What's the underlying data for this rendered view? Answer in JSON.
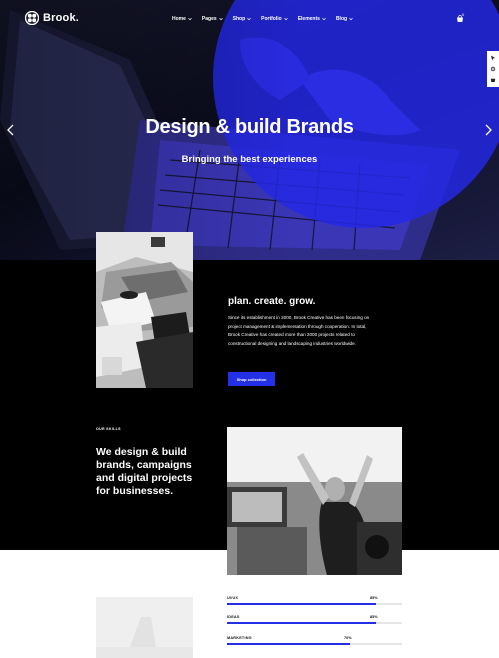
{
  "nav": {
    "logo_text": "Brook.",
    "menu": [
      "Home",
      "Pages",
      "Shop",
      "Portfolio",
      "Elements",
      "Blog"
    ],
    "cart_count": "0"
  },
  "hero": {
    "title": "Design & build Brands",
    "subtitle": "Bringing the best experiences"
  },
  "about": {
    "title": "plan. create. grow.",
    "text": "Since its establishment in 2000, Brook Creative has been focusing on project management & implementation through cooperation. In total, Brook Creative has created more than 2000 projects related to constructional designing and landscaping industries worldwide.",
    "button_label": "Shop collection"
  },
  "skills": {
    "label": "OUR SKILLS",
    "heading": "We design & build brands, campaigns and digital projects for businesses.",
    "items": [
      {
        "name": "UI/UX",
        "percent": 85,
        "percent_label": "85%"
      },
      {
        "name": "IDEAS",
        "percent": 85,
        "percent_label": "85%"
      },
      {
        "name": "MARKETING",
        "percent": 70,
        "percent_label": "70%"
      }
    ]
  },
  "colors": {
    "accent": "#2430e6",
    "dark": "#000000"
  }
}
